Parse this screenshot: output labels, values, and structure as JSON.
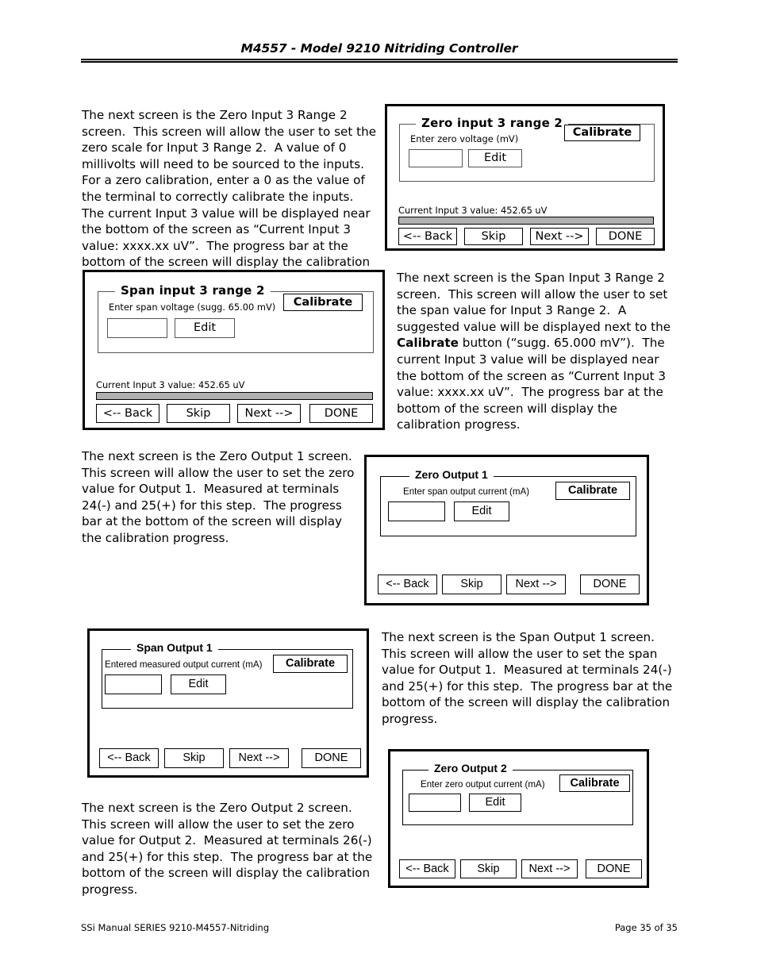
{
  "header": {
    "title": "M4557 - Model 9210 Nitriding Controller"
  },
  "footer": {
    "left": "SSi Manual SERIES 9210-M4557-Nitriding",
    "right": "Page 35 of 35"
  },
  "paragraphs": {
    "zero_input_3_range_2": "The next screen is the Zero Input 3 Range 2 screen.  This screen will allow the user to set the zero scale for Input 3 Range 2.  A value of 0 millivolts will need to be sourced to the inputs.  For a zero calibration, enter a 0 as the value of the terminal to correctly calibrate the inputs.  The current Input 3 value will be displayed near the bottom of the screen as “Current Input 3 value: xxxx.xx uV”.  The progress bar at the bottom of the screen will display the calibration progress.",
    "span_input_3_range_2_a": "The next screen is the Span Input 3 Range 2 screen.  This screen will allow the user to set the span value for Input 3 Range 2.  A suggested value will be displayed next to the ",
    "span_input_3_range_2_bold": "Calibrate",
    "span_input_3_range_2_b": " button (“sugg. 65.000 mV”).  The current Input 3 value will be displayed near the bottom of the screen as “Current Input 3 value: xxxx.xx uV”.  The progress bar at the bottom of the screen will display the calibration progress.",
    "zero_output_1": "The next screen is the Zero Output 1 screen.  This screen will allow the user to set the zero value for Output 1.  Measured at terminals 24(-) and 25(+) for this step.  The progress bar at the bottom of the screen will display the calibration progress.",
    "span_output_1": "The next screen is the Span Output 1 screen.  This screen will allow the user to set the span value for Output 1.  Measured at terminals 24(-) and 25(+) for this step.  The progress bar at the bottom of the screen will display the calibration progress.",
    "zero_output_2": "The next screen is the Zero Output 2 screen.  This screen will allow the user to set the zero value for Output 2.  Measured at terminals 26(-) and 25(+) for this step.  The progress bar at the bottom of the screen will display the calibration progress."
  },
  "screens": {
    "zero_input_3_range_2": {
      "group_title": "Zero input 3 range 2",
      "field_label": "Enter zero voltage (mV)",
      "input_value": "",
      "edit_label": "Edit",
      "calibrate_label": "Calibrate",
      "status": "Current Input 3 value: 452.65 uV",
      "progress_percent": 100,
      "back_label": "<-- Back",
      "skip_label": "Skip",
      "next_label": "Next -->",
      "done_label": "DONE"
    },
    "span_input_3_range_2": {
      "group_title": "Span input 3 range 2",
      "field_label": "Enter span voltage (sugg. 65.00 mV)",
      "input_value": "",
      "edit_label": "Edit",
      "calibrate_label": "Calibrate",
      "status": "Current Input 3 value: 452.65 uV",
      "progress_percent": 100,
      "back_label": "<-- Back",
      "skip_label": "Skip",
      "next_label": "Next -->",
      "done_label": "DONE"
    },
    "zero_output_1": {
      "group_title": "Zero Output 1",
      "field_label": "Enter span output current (mA)",
      "input_value": "",
      "edit_label": "Edit",
      "calibrate_label": "Calibrate",
      "back_label": "<-- Back",
      "skip_label": "Skip",
      "next_label": "Next -->",
      "done_label": "DONE"
    },
    "span_output_1": {
      "group_title": "Span Output 1",
      "field_label": "Entered measured output current (mA)",
      "input_value": "",
      "edit_label": "Edit",
      "calibrate_label": "Calibrate",
      "back_label": "<-- Back",
      "skip_label": "Skip",
      "next_label": "Next -->",
      "done_label": "DONE"
    },
    "zero_output_2": {
      "group_title": "Zero Output 2",
      "field_label": "Enter zero output current (mA)",
      "input_value": "",
      "edit_label": "Edit",
      "calibrate_label": "Calibrate",
      "back_label": "<-- Back",
      "skip_label": "Skip",
      "next_label": "Next -->",
      "done_label": "DONE"
    }
  },
  "colors": {
    "ink": "#000000",
    "progress_fill": "#b0b0b0",
    "paper": "#ffffff"
  }
}
